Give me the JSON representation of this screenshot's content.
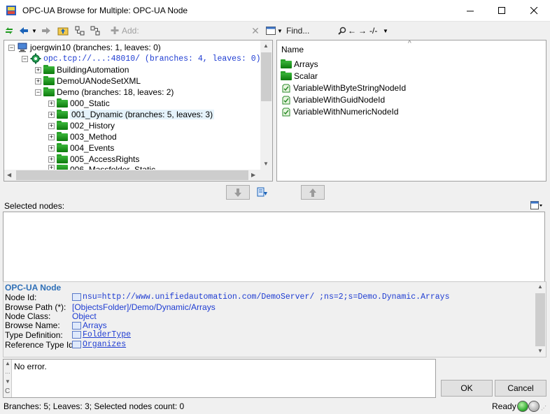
{
  "window": {
    "title": "OPC-UA Browse for Multiple: OPC-UA Node"
  },
  "toolbar": {
    "add_label": "Add:",
    "find_placeholder": "Find...",
    "find_scope": "-/-"
  },
  "tree": {
    "root_label": "joergwin10 (branches: 1, leaves: 0)",
    "server_label": "opc.tcp://...:48010/ (branches: 4, leaves: 0)",
    "items": [
      {
        "label": "BuildingAutomation"
      },
      {
        "label": "DemoUANodeSetXML"
      },
      {
        "label": "Demo (branches: 18, leaves: 2)"
      },
      {
        "label": "000_Static"
      },
      {
        "label": "001_Dynamic (branches: 5, leaves: 3)"
      },
      {
        "label": "002_History"
      },
      {
        "label": "003_Method"
      },
      {
        "label": "004_Events"
      },
      {
        "label": "005_AccessRights"
      },
      {
        "label": "006_Massfolder_Static"
      }
    ]
  },
  "list": {
    "column_header": "Name",
    "items": [
      {
        "label": "Arrays",
        "kind": "folder"
      },
      {
        "label": "Scalar",
        "kind": "folder"
      },
      {
        "label": "VariableWithByteStringNodeId",
        "kind": "variable"
      },
      {
        "label": "VariableWithGuidNodeId",
        "kind": "variable"
      },
      {
        "label": "VariableWithNumericNodeId",
        "kind": "variable"
      }
    ]
  },
  "selected": {
    "label": "Selected nodes:"
  },
  "properties": {
    "heading": "OPC-UA Node",
    "rows": [
      {
        "label": "Node Id:",
        "value": "nsu=http://www.unifiedautomation.com/DemoServer/ ;ns=2;s=Demo.Dynamic.Arrays"
      },
      {
        "label": "Browse Path (*):",
        "value": "[ObjectsFolder]/Demo/Dynamic/Arrays"
      },
      {
        "label": "Node Class:",
        "value": "Object"
      },
      {
        "label": "Browse Name:",
        "value": "Arrays"
      },
      {
        "label": "Type Definition:",
        "value": "FolderType"
      },
      {
        "label": "Reference Type Id:",
        "value": "Organizes"
      }
    ]
  },
  "messages": {
    "text": "No error."
  },
  "buttons": {
    "ok": "OK",
    "cancel": "Cancel"
  },
  "status": {
    "text": "Branches: 5; Leaves: 3; Selected nodes count: 0",
    "ready": "Ready"
  },
  "colors": {
    "accent": "#0078d7",
    "link": "#1e3cd2",
    "heading": "#2e6fb7",
    "folder_green": "#1a9a1a"
  }
}
